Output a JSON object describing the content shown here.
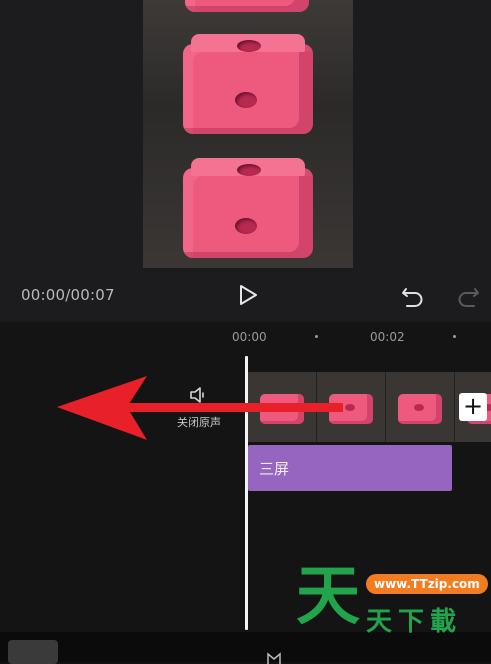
{
  "preview": {
    "time_current": "00:00",
    "time_total": "00:07",
    "time_display": "00:00/00:07",
    "play_icon": "play-icon",
    "undo_icon": "undo-icon",
    "redo_icon": "redo-icon"
  },
  "timeline": {
    "ruler": [
      "00:00",
      "00:02"
    ],
    "mute_label": "关闭原声",
    "mute_icon": "speaker-icon",
    "add_label": "+",
    "text_clip_label": "三屏"
  },
  "watermark": {
    "big_char": "天",
    "url": "www.TTzip.com",
    "text": "天下載"
  },
  "colors": {
    "background": "#131313",
    "text_clip": "#9565c0",
    "arrow": "#e8202a",
    "watermark_green": "#22a44c",
    "watermark_orange": "#f37b20"
  }
}
